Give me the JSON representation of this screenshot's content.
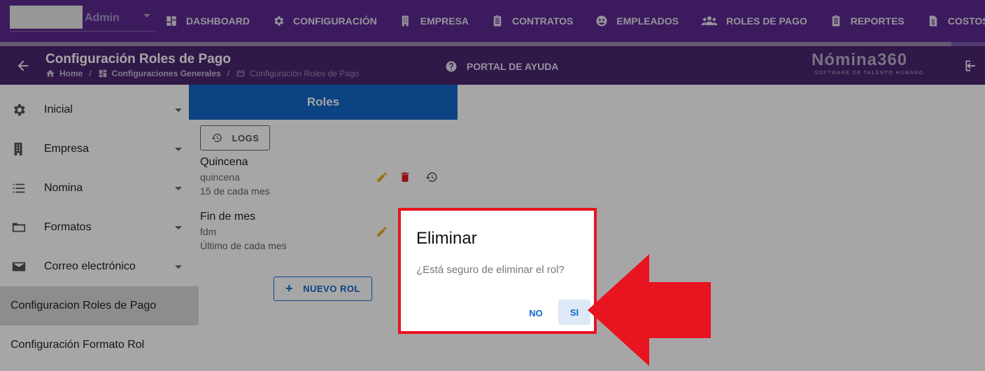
{
  "topbar": {
    "user_name": "Admin",
    "nav": [
      {
        "label": "DASHBOARD",
        "icon": "dashboard-icon"
      },
      {
        "label": "CONFIGURACIÓN",
        "icon": "gear-icon"
      },
      {
        "label": "EMPRESA",
        "icon": "building-icon"
      },
      {
        "label": "CONTRATOS",
        "icon": "clipboard-icon"
      },
      {
        "label": "EMPLEADOS",
        "icon": "people-circle-icon"
      },
      {
        "label": "ROLES DE PAGO",
        "icon": "users-icon"
      },
      {
        "label": "REPORTES",
        "icon": "clipboard-icon"
      },
      {
        "label": "COSTOS",
        "icon": "dollar-file-icon"
      }
    ]
  },
  "header": {
    "title": "Configuración Roles de Pago",
    "breadcrumb": [
      "Home",
      "Configuraciones Generales",
      "Configuración Roles de Pago"
    ],
    "help_label": "PORTAL DE AYUDA",
    "logo_main": "Nómina360",
    "logo_tag": "SOFTWARE DE TALENTO HUMANO"
  },
  "sidebar": {
    "items": [
      {
        "label": "Inicial",
        "icon": "gear-icon"
      },
      {
        "label": "Empresa",
        "icon": "building-icon"
      },
      {
        "label": "Nomina",
        "icon": "list-icon"
      },
      {
        "label": "Formatos",
        "icon": "folder-icon"
      },
      {
        "label": "Correo electrónico",
        "icon": "mail-icon"
      },
      {
        "label": "Configuracion Roles de Pago"
      },
      {
        "label": "Configuración Formato Rol"
      }
    ]
  },
  "main": {
    "tab_label": "Roles",
    "logs_label": "LOGS",
    "roles": [
      {
        "name": "Quincena",
        "code": "quincena",
        "desc": "15 de cada mes"
      },
      {
        "name": "Fin de mes",
        "code": "fdm",
        "desc": "Último de cada mes"
      }
    ],
    "new_role_label": "NUEVO ROL"
  },
  "dialog": {
    "title": "Eliminar",
    "message": "¿Está seguro de eliminar el rol?",
    "no_label": "NO",
    "yes_label": "SI"
  },
  "colors": {
    "nav_bg": "#5b2a8f",
    "subheader_bg": "#4a2670",
    "primary": "#1167c9",
    "highlight": "#e8141f"
  }
}
